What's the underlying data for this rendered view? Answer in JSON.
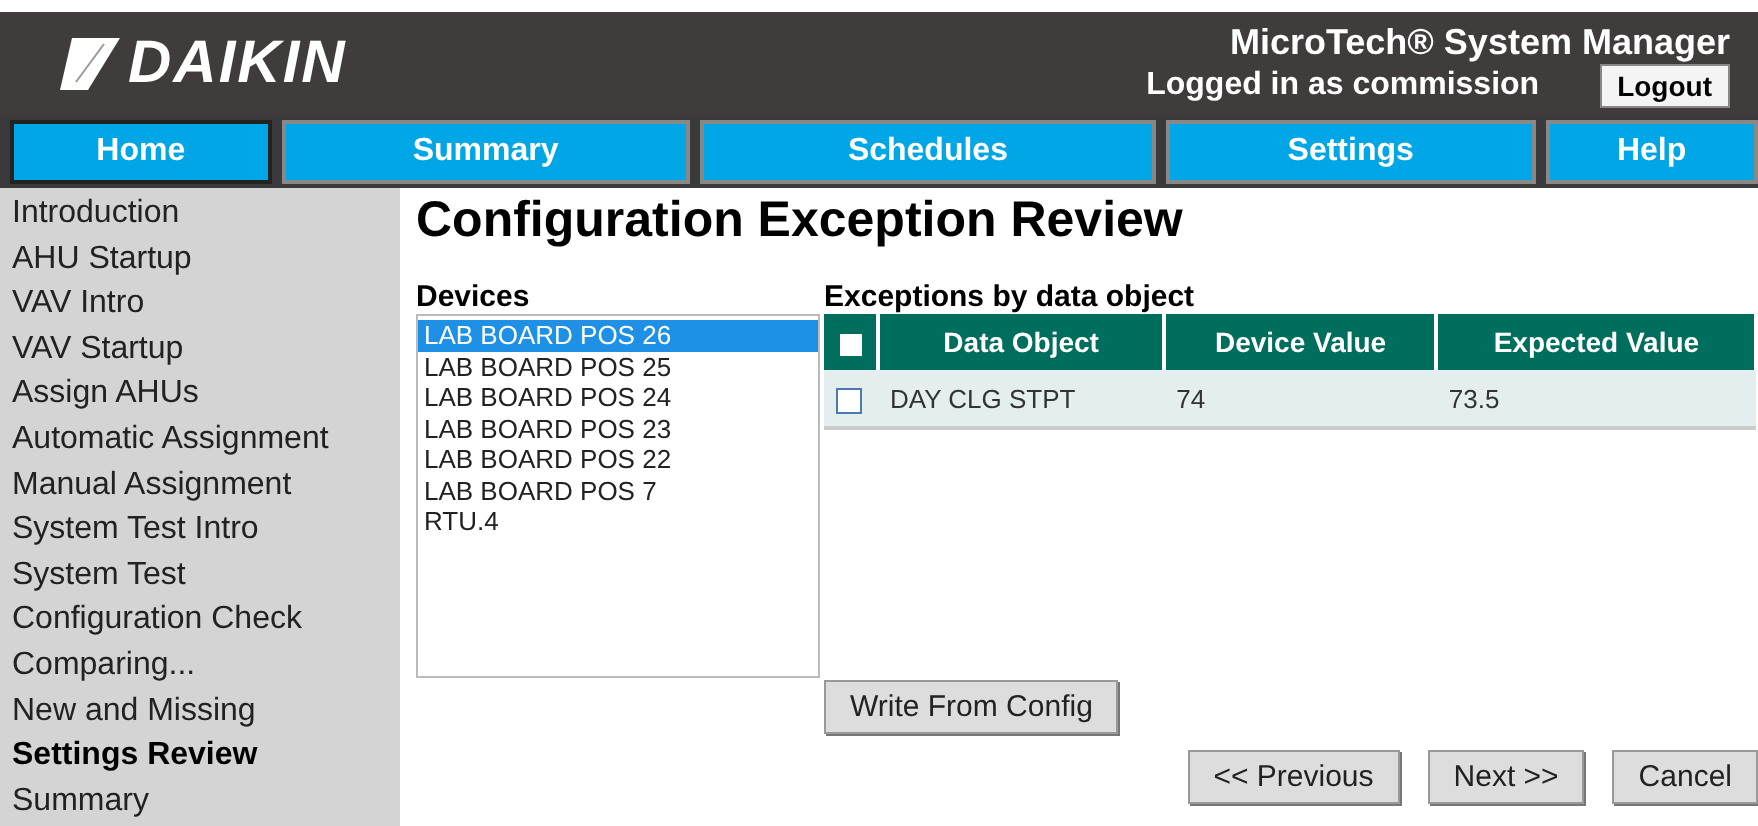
{
  "header": {
    "logo": "DAIKIN",
    "app_title": "MicroTech® System Manager",
    "login_status": "Logged in as commission",
    "logout_button": "Logout"
  },
  "nav_tabs": [
    {
      "label": "Home",
      "selected": true
    },
    {
      "label": "Summary",
      "selected": false
    },
    {
      "label": "Schedules",
      "selected": false
    },
    {
      "label": "Settings",
      "selected": false
    },
    {
      "label": "Help",
      "selected": false
    }
  ],
  "sidebar": {
    "items": [
      {
        "label": "Introduction",
        "selected": false
      },
      {
        "label": "AHU Startup",
        "selected": false
      },
      {
        "label": "VAV Intro",
        "selected": false
      },
      {
        "label": "VAV Startup",
        "selected": false
      },
      {
        "label": "Assign AHUs",
        "selected": false
      },
      {
        "label": "Automatic Assignment",
        "selected": false
      },
      {
        "label": "Manual Assignment",
        "selected": false
      },
      {
        "label": "System Test Intro",
        "selected": false
      },
      {
        "label": "System Test",
        "selected": false
      },
      {
        "label": "Configuration Check",
        "selected": false
      },
      {
        "label": "Comparing...",
        "selected": false
      },
      {
        "label": "New and Missing",
        "selected": false
      },
      {
        "label": "Settings Review",
        "selected": true
      },
      {
        "label": "Summary",
        "selected": false
      }
    ]
  },
  "page_title": "Configuration Exception Review",
  "devices": {
    "heading": "Devices",
    "items": [
      {
        "label": "LAB BOARD POS 26",
        "selected": true
      },
      {
        "label": "LAB BOARD POS 25",
        "selected": false
      },
      {
        "label": "LAB BOARD POS 24",
        "selected": false
      },
      {
        "label": "LAB BOARD POS 23",
        "selected": false
      },
      {
        "label": "LAB BOARD POS 22",
        "selected": false
      },
      {
        "label": "LAB BOARD POS 7",
        "selected": false
      },
      {
        "label": "RTU.4",
        "selected": false
      }
    ]
  },
  "exceptions": {
    "heading": "Exceptions by data object",
    "select_all_checked": false,
    "columns": [
      "Data Object",
      "Device Value",
      "Expected Value"
    ],
    "rows": [
      {
        "checked": false,
        "cells": [
          "DAY CLG STPT",
          "74",
          "73.5"
        ]
      }
    ],
    "write_button": "Write From Config"
  },
  "buttons": [
    "<< Previous",
    "Next >>",
    "Cancel"
  ]
}
